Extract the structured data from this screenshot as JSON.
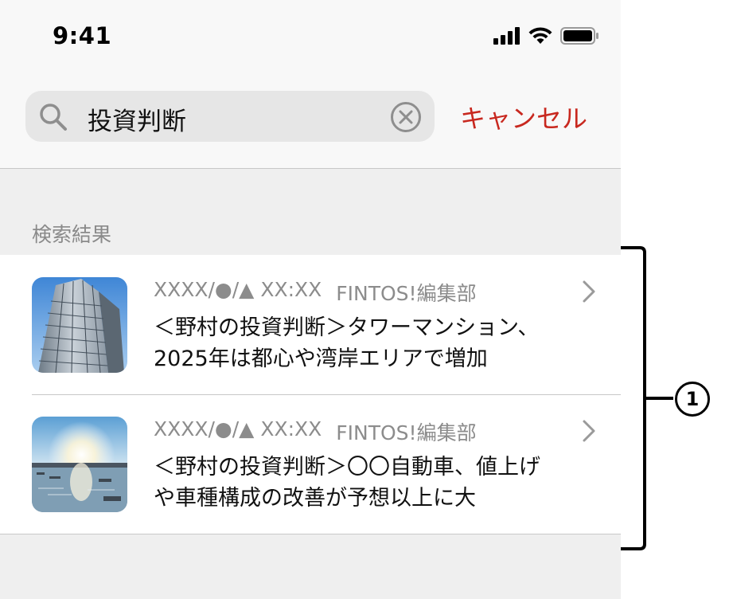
{
  "status_bar": {
    "time": "9:41"
  },
  "search": {
    "value": "投資判断",
    "cancel_label": "キャンセル"
  },
  "section": {
    "title": "検索結果"
  },
  "results": [
    {
      "date": "XXXX/●/▲ XX:XX",
      "source": "FINTOS!編集部",
      "line1": "＜野村の投資判断＞タワーマンション、",
      "line2": "2025年は都心や湾岸エリアで増加",
      "thumbnail": "tower-building-image"
    },
    {
      "date": "XXXX/●/▲ XX:XX",
      "source": "FINTOS!編集部",
      "line1": "＜野村の投資判断＞〇〇自動車、値上げ",
      "line2": "や車種構成の改善が予想以上に大",
      "thumbnail": "harbor-sunrise-image"
    }
  ],
  "annotation": {
    "callout": "1"
  },
  "colors": {
    "accent": "#c8281f",
    "meta_text": "#8c8c8c",
    "background": "#efefef"
  }
}
